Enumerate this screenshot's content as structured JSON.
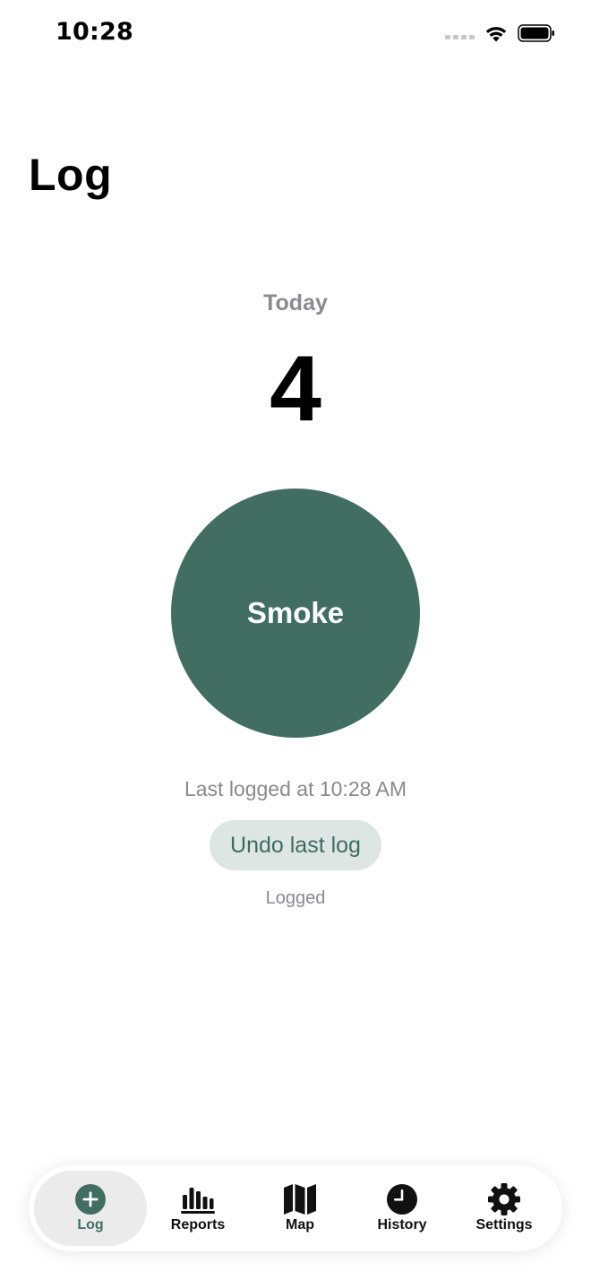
{
  "status_bar": {
    "time": "10:28"
  },
  "header": {
    "title": "Log"
  },
  "main": {
    "period_label": "Today",
    "count": "4",
    "action_button_label": "Smoke",
    "last_logged_text": "Last logged at 10:28 AM",
    "undo_button_label": "Undo last log",
    "status_text": "Logged"
  },
  "colors": {
    "accent": "#426e62",
    "undo_bg": "#dde6e2",
    "secondary_text": "#8a8a8e"
  },
  "tab_bar": {
    "selected": "Log",
    "items": [
      {
        "label": "Log",
        "icon": "plus-circle-icon"
      },
      {
        "label": "Reports",
        "icon": "bar-chart-icon"
      },
      {
        "label": "Map",
        "icon": "map-icon"
      },
      {
        "label": "History",
        "icon": "clock-icon"
      },
      {
        "label": "Settings",
        "icon": "gear-icon"
      }
    ]
  }
}
